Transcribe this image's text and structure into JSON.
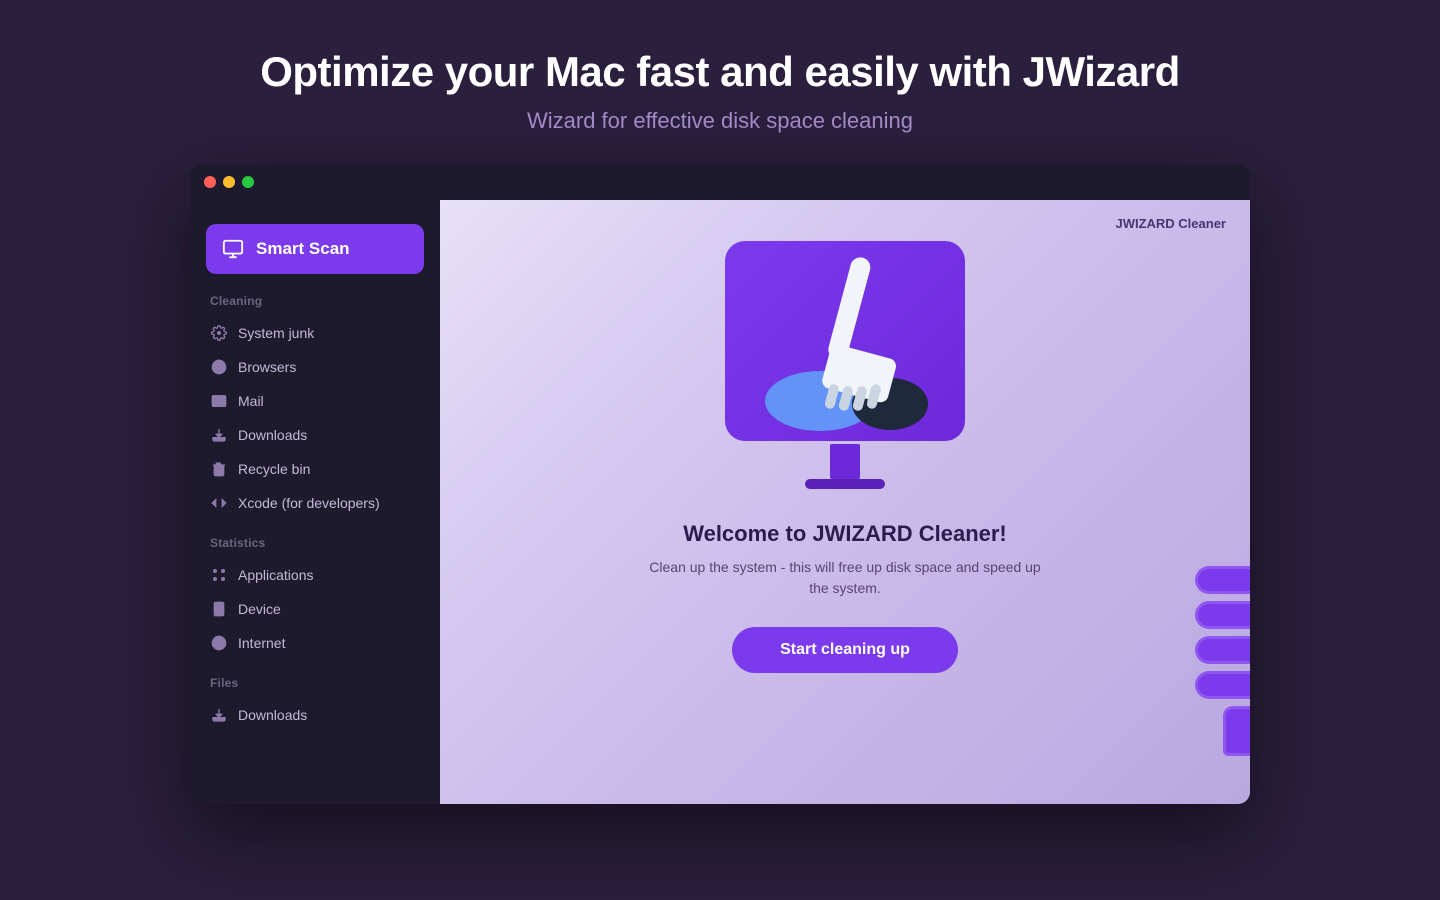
{
  "page": {
    "title": "Optimize your Mac fast and easily with JWizard",
    "subtitle": "Wizard for effective disk space cleaning"
  },
  "titlebar": {
    "traffic_lights": [
      "red",
      "yellow",
      "green"
    ]
  },
  "sidebar": {
    "smart_scan_label": "Smart Scan",
    "sections": [
      {
        "name": "Cleaning",
        "items": [
          {
            "id": "system-junk",
            "label": "System junk",
            "icon": "gear"
          },
          {
            "id": "browsers",
            "label": "Browsers",
            "icon": "globe"
          },
          {
            "id": "mail",
            "label": "Mail",
            "icon": "mail"
          },
          {
            "id": "downloads",
            "label": "Downloads",
            "icon": "download"
          },
          {
            "id": "recycle-bin",
            "label": "Recycle bin",
            "icon": "trash"
          },
          {
            "id": "xcode",
            "label": "Xcode (for developers)",
            "icon": "code"
          }
        ]
      },
      {
        "name": "Statistics",
        "items": [
          {
            "id": "applications",
            "label": "Applications",
            "icon": "apps"
          },
          {
            "id": "device",
            "label": "Device",
            "icon": "device"
          },
          {
            "id": "internet",
            "label": "Internet",
            "icon": "globe"
          }
        ]
      },
      {
        "name": "Files",
        "items": [
          {
            "id": "files-downloads",
            "label": "Downloads",
            "icon": "download"
          }
        ]
      }
    ]
  },
  "main": {
    "app_name": "JWIZARD Cleaner",
    "welcome_title": "Welcome to JWIZARD Cleaner!",
    "welcome_desc": "Clean up the system - this will free up disk space and speed up the system.",
    "start_button_label": "Start cleaning up"
  }
}
